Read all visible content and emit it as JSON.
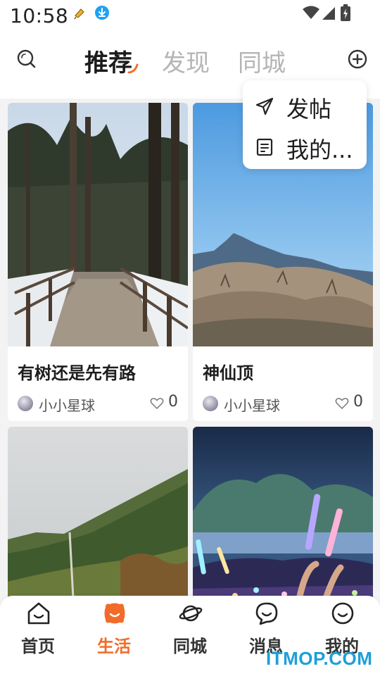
{
  "status_bar": {
    "time": "10:58"
  },
  "top_bar": {
    "tabs": [
      {
        "label": "推荐",
        "active": true
      },
      {
        "label": "发现",
        "active": false
      },
      {
        "label": "同城",
        "active": false
      }
    ],
    "icons": {
      "search": "search-icon",
      "add": "plus-circle-icon"
    }
  },
  "popup_menu": {
    "items": [
      {
        "label": "发帖",
        "icon": "send-icon"
      },
      {
        "label": "我的...",
        "icon": "document-icon"
      }
    ]
  },
  "feed": {
    "cards": [
      {
        "title": "有树还是先有路",
        "author": "小小星球",
        "likes": "0",
        "image": "forest-boardwalk-photo"
      },
      {
        "title": "神仙顶",
        "author": "小小星球",
        "likes": "0",
        "image": "mountain-peak-photo"
      },
      {
        "title": "",
        "author": "",
        "likes": "",
        "image": "green-hillside-photo"
      },
      {
        "title": "",
        "author": "",
        "likes": "",
        "image": "concert-glowsticks-photo"
      }
    ]
  },
  "bottom_nav": {
    "items": [
      {
        "label": "首页",
        "icon": "home-face-icon",
        "active": false
      },
      {
        "label": "生活",
        "icon": "life-icon",
        "active": true
      },
      {
        "label": "同城",
        "icon": "planet-icon",
        "active": false
      },
      {
        "label": "消息",
        "icon": "message-bubble-icon",
        "active": false
      },
      {
        "label": "我的",
        "icon": "profile-face-icon",
        "active": false
      }
    ]
  },
  "watermark": "ITMOP.COM",
  "colors": {
    "accent": "#f26b2a",
    "background": "#f3f3f3",
    "watermark": "#1d9fd8"
  }
}
